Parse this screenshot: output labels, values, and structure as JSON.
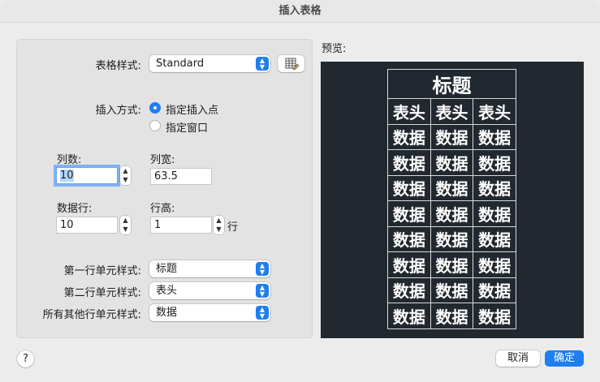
{
  "window": {
    "title": "插入表格"
  },
  "left": {
    "table_style_label": "表格样式:",
    "table_style_value": "Standard",
    "insert_mode_label": "插入方式:",
    "insert_mode_options": [
      "指定插入点",
      "指定窗口"
    ],
    "insert_mode_selected": "指定插入点",
    "columns_label": "列数:",
    "columns_value": "10",
    "col_width_label": "列宽:",
    "col_width_value": "63.5",
    "data_rows_label": "数据行:",
    "data_rows_value": "10",
    "row_height_label": "行高:",
    "row_height_value": "1",
    "row_height_unit": "行",
    "first_row_style_label": "第一行单元样式:",
    "first_row_style_value": "标题",
    "second_row_style_label": "第二行单元样式:",
    "second_row_style_value": "表头",
    "other_rows_style_label": "所有其他行单元样式:",
    "other_rows_style_value": "数据"
  },
  "preview": {
    "label": "预览:",
    "title_cell": "标题",
    "header_cells": [
      "表头",
      "表头",
      "表头"
    ],
    "data_cell": "数据",
    "data_row_count": 8
  },
  "footer": {
    "help": "?",
    "cancel": "取消",
    "ok": "确定"
  },
  "colors": {
    "accent": "#1f7ef0",
    "preview_bg": "#222830"
  }
}
